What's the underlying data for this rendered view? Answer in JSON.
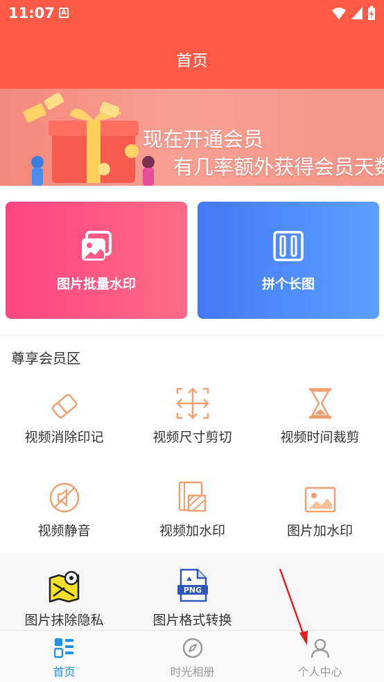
{
  "status_bar": {
    "time": "11:07",
    "notification_badge": "A"
  },
  "header": {
    "title": "首页"
  },
  "banner": {
    "line1": "现在开通会员",
    "line2": "有几率额外获得会员天数"
  },
  "feature_cards": [
    {
      "label": "图片批量水印",
      "icon": "image-stack-icon",
      "color": "#ff4d82"
    },
    {
      "label": "拼个长图",
      "icon": "long-image-icon",
      "color": "#4d86f8"
    }
  ],
  "vip_section": {
    "title": "尊享会员区",
    "items": [
      {
        "label": "视频消除印记",
        "icon": "eraser-icon"
      },
      {
        "label": "视频尺寸剪切",
        "icon": "resize-arrows-icon"
      },
      {
        "label": "视频时间裁剪",
        "icon": "hourglass-icon"
      },
      {
        "label": "视频静音",
        "icon": "mute-icon"
      },
      {
        "label": "视频加水印",
        "icon": "video-watermark-icon"
      },
      {
        "label": "图片加水印",
        "icon": "picture-watermark-icon"
      },
      {
        "label": "图片抹除隐私",
        "icon": "map-privacy-icon"
      },
      {
        "label": "图片格式转换",
        "icon": "png-file-icon",
        "badge": "PNG"
      }
    ]
  },
  "tabbar": {
    "items": [
      {
        "label": "首页",
        "icon": "home-grid-icon",
        "active": true
      },
      {
        "label": "时光相册",
        "icon": "compass-icon",
        "active": false
      },
      {
        "label": "个人中心",
        "icon": "person-icon",
        "active": false
      }
    ]
  },
  "colors": {
    "header": "#ff5a45",
    "accent_orange": "#f0a070",
    "tab_active": "#1e90e8",
    "tab_inactive": "#9a9a9a",
    "annotation_arrow": "#e02020"
  }
}
